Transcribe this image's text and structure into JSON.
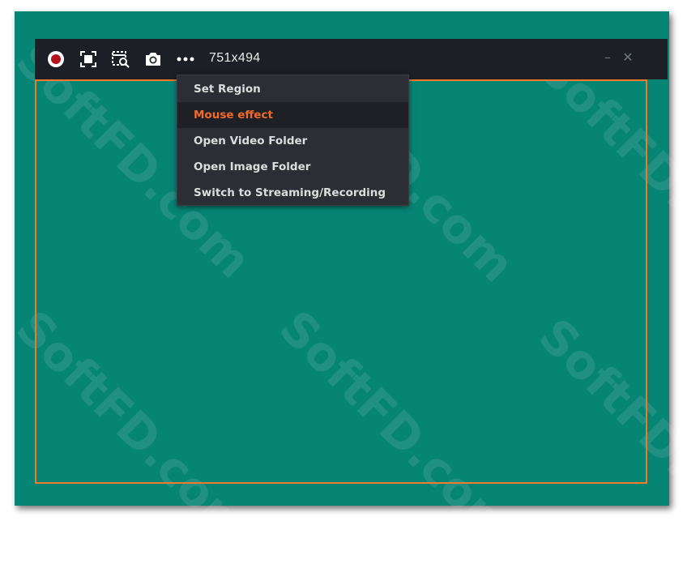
{
  "toolbar": {
    "buttons": [
      {
        "icon": "record-icon"
      },
      {
        "icon": "fullscreen-icon"
      },
      {
        "icon": "select-window-icon"
      },
      {
        "icon": "camera-icon"
      },
      {
        "icon": "more-icon"
      }
    ],
    "dimensions": "751x494",
    "window_controls": {
      "minimize": "–",
      "close": "✕"
    }
  },
  "menu": {
    "items": [
      {
        "label": "Set Region",
        "active": false
      },
      {
        "label": "Mouse effect",
        "active": true
      },
      {
        "label": "Open Video Folder",
        "active": false
      },
      {
        "label": "Open Image Folder",
        "active": false
      },
      {
        "label": "Switch to Streaming/Recording",
        "active": false
      }
    ]
  },
  "watermark": {
    "text": "SoftFD.com"
  },
  "colors": {
    "background": "#068474",
    "toolbar": "#1c1f26",
    "region_border": "#f07a2a",
    "menu_bg": "#2b2e35",
    "menu_active_text": "#f26a2b",
    "record_red": "#b5121b"
  }
}
